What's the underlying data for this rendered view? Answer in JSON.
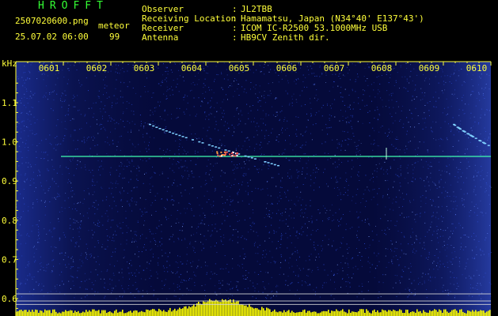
{
  "header": {
    "app_title": "HROFFT",
    "file_name": "2507020600.png",
    "date_time": "25.07.02 06:00",
    "meteor_label": "meteor",
    "meteor_count": "99"
  },
  "info": [
    {
      "label": "Observer",
      "value": "JL2TBB"
    },
    {
      "label": "Receiving Location",
      "value": "Hamamatsu, Japan (N34°40' E137°43')"
    },
    {
      "label": "Receiver",
      "value": "ICOM IC-R2500 53.1000MHz USB"
    },
    {
      "label": "Antenna",
      "value": "HB9CV Zenith dir."
    }
  ],
  "colors": {
    "background": "#000000",
    "plot_background": "#050a3a",
    "noise": "#2c4cd8",
    "text": "#ffff3a",
    "title": "#34ff34",
    "carrier": "#40ffb0",
    "meteor_trail": "#7fd0ff",
    "meteor_head": "#ff5050",
    "level_bars": "#ffff00",
    "reference_lines": "#d8d8d8"
  },
  "chart_data": {
    "type": "heatmap",
    "subtype": "spectrogram",
    "ylabel": "kHz",
    "xlabel": "",
    "x_ticks": [
      "0601",
      "0602",
      "0603",
      "0604",
      "0605",
      "0606",
      "0607",
      "0608",
      "0609",
      "0610"
    ],
    "y_ticks": [
      "1.1",
      "1.0",
      "0.9",
      "0.8",
      "0.7",
      "0.6"
    ],
    "xlim": [
      0,
      10
    ],
    "ylim": [
      0.575,
      1.15
    ],
    "carrier_line": {
      "freq_khz": 0.963,
      "x_start_min": 0.95,
      "x_end_min": 10.0
    },
    "meteor_echoes": [
      {
        "name": "main echo",
        "x_start_min": 2.8,
        "x_end_min": 5.5,
        "freq_start_khz": 1.045,
        "freq_end_khz": 0.94,
        "head_min": 4.4
      },
      {
        "name": "late echo",
        "x_start_min": 9.2,
        "x_end_min": 9.95,
        "freq_start_khz": 1.045,
        "freq_end_khz": 0.99
      }
    ],
    "reference_lines_khz": [
      0.612,
      0.594,
      0.585
    ],
    "level_bars": {
      "peak_min": 4.3,
      "min_fraction": 0.15,
      "max_fraction": 0.8
    }
  }
}
